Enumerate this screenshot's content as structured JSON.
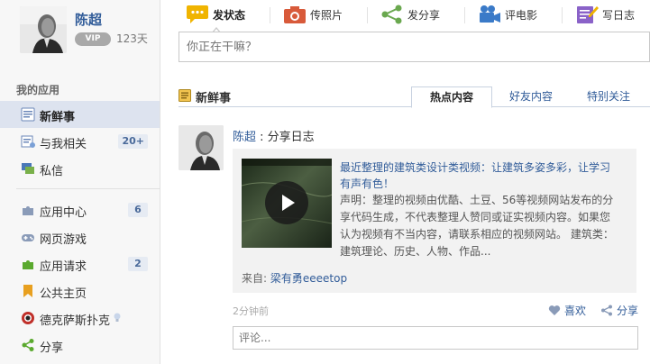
{
  "profile": {
    "name": "陈超",
    "vip_label": "VIP",
    "days": "123天"
  },
  "sidebar": {
    "section_title": "我的应用",
    "items": [
      {
        "label": "新鲜事",
        "badge": ""
      },
      {
        "label": "与我相关",
        "badge": "20+"
      },
      {
        "label": "私信",
        "badge": ""
      },
      {
        "label": "应用中心",
        "badge": "6"
      },
      {
        "label": "网页游戏",
        "badge": ""
      },
      {
        "label": "应用请求",
        "badge": "2"
      },
      {
        "label": "公共主页",
        "badge": ""
      },
      {
        "label": "德克萨斯扑克",
        "badge": ""
      },
      {
        "label": "分享",
        "badge": ""
      }
    ]
  },
  "publisher": {
    "actions": [
      {
        "label": "发状态",
        "icon": "chat-bubble-icon"
      },
      {
        "label": "传照片",
        "icon": "camera-icon"
      },
      {
        "label": "发分享",
        "icon": "share-icon"
      },
      {
        "label": "评电影",
        "icon": "movie-camera-icon"
      },
      {
        "label": "写日志",
        "icon": "pencil-note-icon"
      }
    ],
    "placeholder": "你正在干嘛？"
  },
  "feed": {
    "title": "新鲜事",
    "tabs": [
      "热点内容",
      "好友内容",
      "特别关注"
    ],
    "entry": {
      "author": "陈超",
      "action": " : 分享日志",
      "share_title": "最近整理的建筑类设计类视频：让建筑多姿多彩，让学习有声有色！",
      "share_desc": "声明：整理的视频由优酷、土豆、56等视频网站发布的分享代码生成，不代表整理人赞同或证实视频内容。如果您认为视频有不当内容，请联系相应的视频网站。 建筑类：建筑理论、历史、人物、作品...",
      "from_label": "来自: ",
      "from_name": "梁有勇eeeetop",
      "time": "2分钟前",
      "like_label": "喜欢",
      "share_label": "分享",
      "comment_placeholder": "评论..."
    }
  },
  "colors": {
    "link": "#315c99",
    "active_nav": "#dde3ef"
  }
}
